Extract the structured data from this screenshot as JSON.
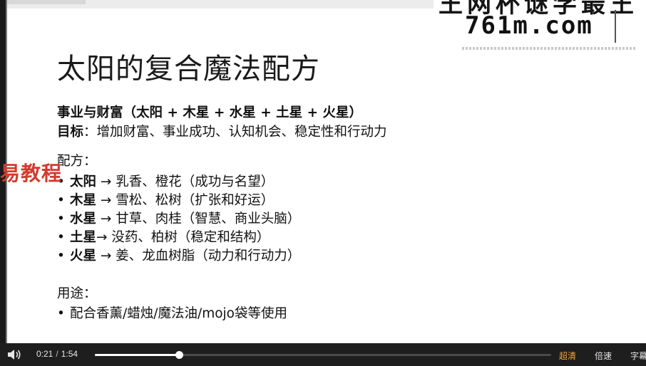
{
  "watermark": {
    "top_text": "王网杯谜学最王",
    "url": "761m.com"
  },
  "side_label": "易教程",
  "slide": {
    "title": "太阳的复合魔法配方",
    "section_heading": "事业与财富（太阳 + 木星 + 水星 + 土星 + 火星）",
    "goal_label": "目标",
    "goal_text": "：增加财富、事业成功、认知机会、稳定性和行动力",
    "recipe_label": "配方：",
    "recipes": [
      {
        "planet": "太阳",
        "arrow": " → ",
        "text": "乳香、橙花（成功与名望）"
      },
      {
        "planet": "木星",
        "arrow": " → ",
        "text": "雪松、松树（扩张和好运）"
      },
      {
        "planet": "水星",
        "arrow": " → ",
        "text": "甘草、肉桂（智慧、商业头脑）"
      },
      {
        "planet": "土星",
        "arrow": "→ ",
        "text": "没药、柏树（稳定和结构）"
      },
      {
        "planet": "火星",
        "arrow": " → ",
        "text": "姜、龙血树脂（动力和行动力）"
      }
    ],
    "usage_label": "用途：",
    "usage_items": [
      "配合香薰/蜡烛/魔法油/mojo袋等使用"
    ]
  },
  "player": {
    "current_time": "0:21",
    "separator": "/",
    "total_time": "1:54",
    "progress_fraction": 0.184,
    "buffered_fraction": 1.0,
    "quality_label": "超清",
    "speed_label": "倍速",
    "subtitle_label": "字幕",
    "accent_color": "#f2a33a",
    "volume_icon": "speaker-icon"
  }
}
